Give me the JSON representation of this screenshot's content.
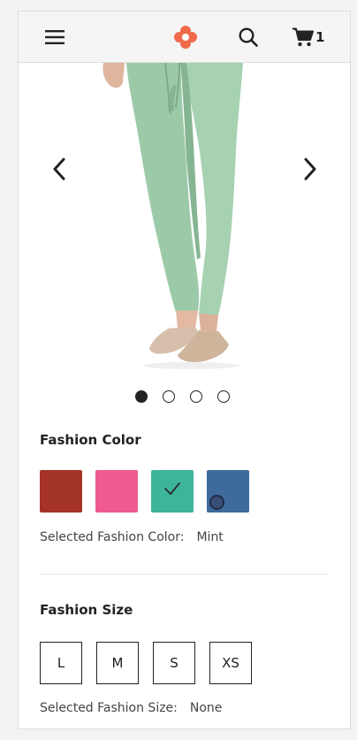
{
  "header": {
    "cart_count": "1",
    "icons": [
      "menu-icon",
      "logo-icon",
      "search-icon",
      "cart-icon"
    ]
  },
  "gallery": {
    "slide_count": 4,
    "active_slide": 1
  },
  "color_section": {
    "title": "Fashion Color",
    "swatches": [
      {
        "name": "Red",
        "color": "#a33427"
      },
      {
        "name": "Pink",
        "color": "#ef5a93"
      },
      {
        "name": "Mint",
        "color": "#3cb59a"
      },
      {
        "name": "Blue",
        "color": "#3e6b9b"
      }
    ],
    "selected_label": "Selected Fashion Color:",
    "selected_value": "Mint"
  },
  "size_section": {
    "title": "Fashion Size",
    "sizes": [
      "L",
      "M",
      "S",
      "XS"
    ],
    "selected_label": "Selected Fashion Size:",
    "selected_value": "None"
  },
  "colors": {
    "brand_orange": "#f06a4b",
    "pants_mint": "#9ccaa9",
    "shoe_beige": "#d7c0ab"
  }
}
